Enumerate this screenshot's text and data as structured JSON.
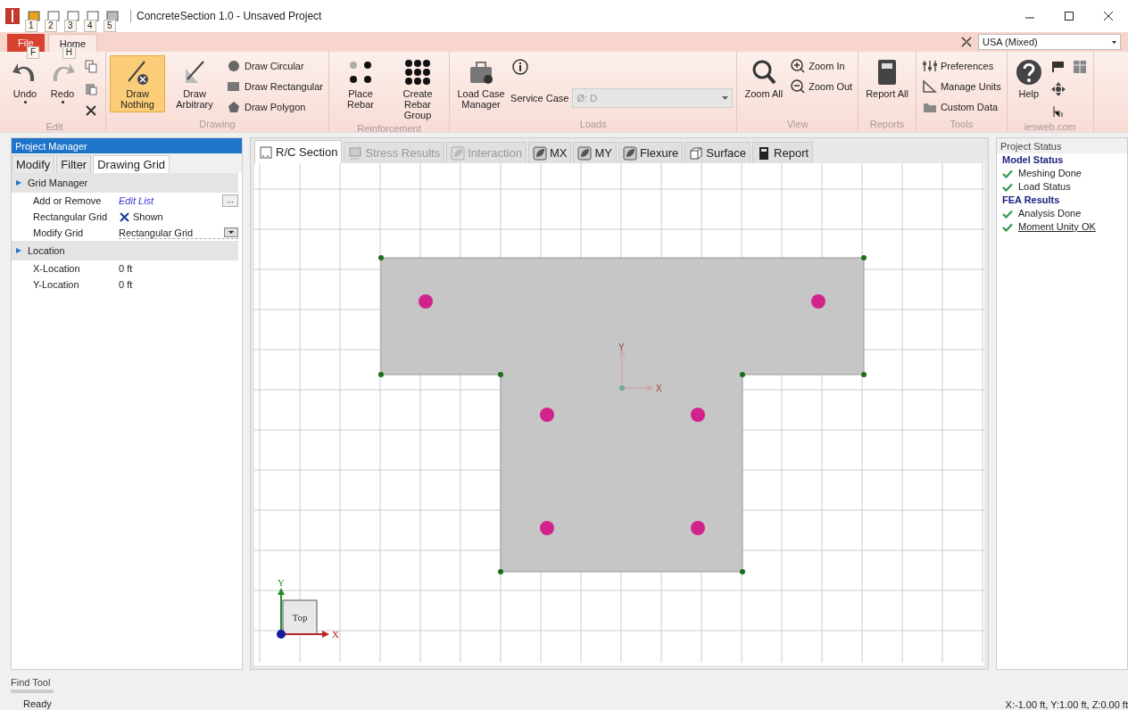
{
  "window": {
    "title": "ConcreteSection 1.0 - Unsaved Project"
  },
  "quick_access_keytips": [
    "1",
    "2",
    "3",
    "4",
    "5"
  ],
  "ribbon_tabs": [
    {
      "label": "File",
      "kind": "file",
      "keytip": "F",
      "selected": false
    },
    {
      "label": "Home",
      "kind": "tab",
      "keytip": "H",
      "selected": true
    }
  ],
  "units": {
    "value": "USA (Mixed)"
  },
  "ribbon_groups": [
    {
      "label": "Edit",
      "items": [
        {
          "kind": "large",
          "label": "Undo",
          "selected": false,
          "dropdown": true
        },
        {
          "kind": "large",
          "label": "Redo",
          "selected": false,
          "dropdown": true
        },
        {
          "kind": "tool"
        },
        {
          "kind": "tool"
        },
        {
          "kind": "tool"
        }
      ]
    },
    {
      "label": "Drawing",
      "items": [
        {
          "kind": "large",
          "label": "Draw Nothing",
          "selected": true,
          "dropdown": false
        },
        {
          "kind": "large",
          "label": "Draw Arbitrary",
          "selected": false,
          "dropdown": false
        },
        {
          "kind": "small",
          "label": "Draw Circular"
        },
        {
          "kind": "small",
          "label": "Draw Rectangular"
        },
        {
          "kind": "small",
          "label": "Draw Polygon"
        }
      ]
    },
    {
      "label": "Reinforcement",
      "items": [
        {
          "kind": "large",
          "label": "Place Rebar",
          "selected": false,
          "dropdown": false
        },
        {
          "kind": "large",
          "label": "Create Rebar Group",
          "selected": false,
          "dropdown": false
        }
      ]
    },
    {
      "label": "Loads",
      "items": [
        {
          "kind": "large",
          "label": "Load Case Manager",
          "selected": false,
          "dropdown": false
        },
        {
          "kind": "tool"
        },
        {
          "kind": "field",
          "label": "Service Case",
          "value": "Ø: D",
          "disabled": true
        }
      ]
    },
    {
      "label": "View",
      "items": [
        {
          "kind": "large",
          "label": "Zoom All",
          "selected": false,
          "dropdown": false
        },
        {
          "kind": "small",
          "label": "Zoom In"
        },
        {
          "kind": "small",
          "label": "Zoom Out"
        }
      ]
    },
    {
      "label": "Reports",
      "items": [
        {
          "kind": "large",
          "label": "Report All",
          "selected": false,
          "dropdown": false
        }
      ]
    },
    {
      "label": "Tools",
      "items": [
        {
          "kind": "small",
          "label": "Preferences"
        },
        {
          "kind": "small",
          "label": "Manage Units"
        },
        {
          "kind": "small",
          "label": "Custom Data"
        }
      ]
    },
    {
      "label": "iesweb.com",
      "items": [
        {
          "kind": "large",
          "label": "Help",
          "selected": false,
          "dropdown": false
        },
        {
          "kind": "tool"
        },
        {
          "kind": "tool"
        },
        {
          "kind": "tool"
        },
        {
          "kind": "tool"
        }
      ]
    }
  ],
  "project_manager": {
    "title": "Project Manager",
    "tabs": [
      {
        "label": "Modify",
        "selected": false
      },
      {
        "label": "Filter",
        "selected": false
      },
      {
        "label": "Drawing Grid",
        "selected": true
      }
    ],
    "categories": [
      {
        "label": "Grid Manager",
        "expanded": true,
        "rows": [
          {
            "kind": "link",
            "label": "Add or Remove",
            "value": "Edit List",
            "button": "..."
          },
          {
            "kind": "checkbox",
            "label": "Rectangular Grid",
            "value": "Shown",
            "checked": true
          },
          {
            "kind": "dropdown",
            "label": "Modify Grid",
            "value": "Rectangular Grid"
          }
        ]
      },
      {
        "label": "Location",
        "expanded": true,
        "rows": [
          {
            "kind": "text",
            "label": "X-Location",
            "value": "0 ft"
          },
          {
            "kind": "text",
            "label": "Y-Location",
            "value": "0 ft"
          }
        ]
      }
    ]
  },
  "document_tabs": [
    {
      "label": "R/C Section",
      "selected": true,
      "disabled": false
    },
    {
      "label": "Stress Results",
      "selected": false,
      "disabled": true
    },
    {
      "label": "Interaction",
      "selected": false,
      "disabled": true
    },
    {
      "label": "MX",
      "selected": false,
      "disabled": false
    },
    {
      "label": "MY",
      "selected": false,
      "disabled": false
    },
    {
      "label": "Flexure",
      "selected": false,
      "disabled": false
    },
    {
      "label": "Surface",
      "selected": false,
      "disabled": false
    },
    {
      "label": "Report",
      "selected": false,
      "disabled": false
    }
  ],
  "canvas": {
    "origin_axes": {
      "x_label": "X",
      "y_label": "Y"
    },
    "view_cube": {
      "label": "Top",
      "x_label": "X",
      "y_label": "Y"
    }
  },
  "project_status": {
    "title": "Project Status",
    "sections": [
      {
        "title": "Model Status",
        "items": [
          {
            "label": "Meshing Done",
            "done": true,
            "link": false
          },
          {
            "label": "Load Status",
            "done": true,
            "link": false
          }
        ]
      },
      {
        "title": "FEA Results",
        "items": [
          {
            "label": "Analysis Done",
            "done": true,
            "link": false
          },
          {
            "label": "Moment Unity OK",
            "done": true,
            "link": true
          }
        ]
      }
    ]
  },
  "find_tool": {
    "label": "Find Tool"
  },
  "status_bar": {
    "message": "Ready",
    "coordinates": "X:-1.00 ft, Y:1.00 ft, Z:0.00 ft"
  }
}
